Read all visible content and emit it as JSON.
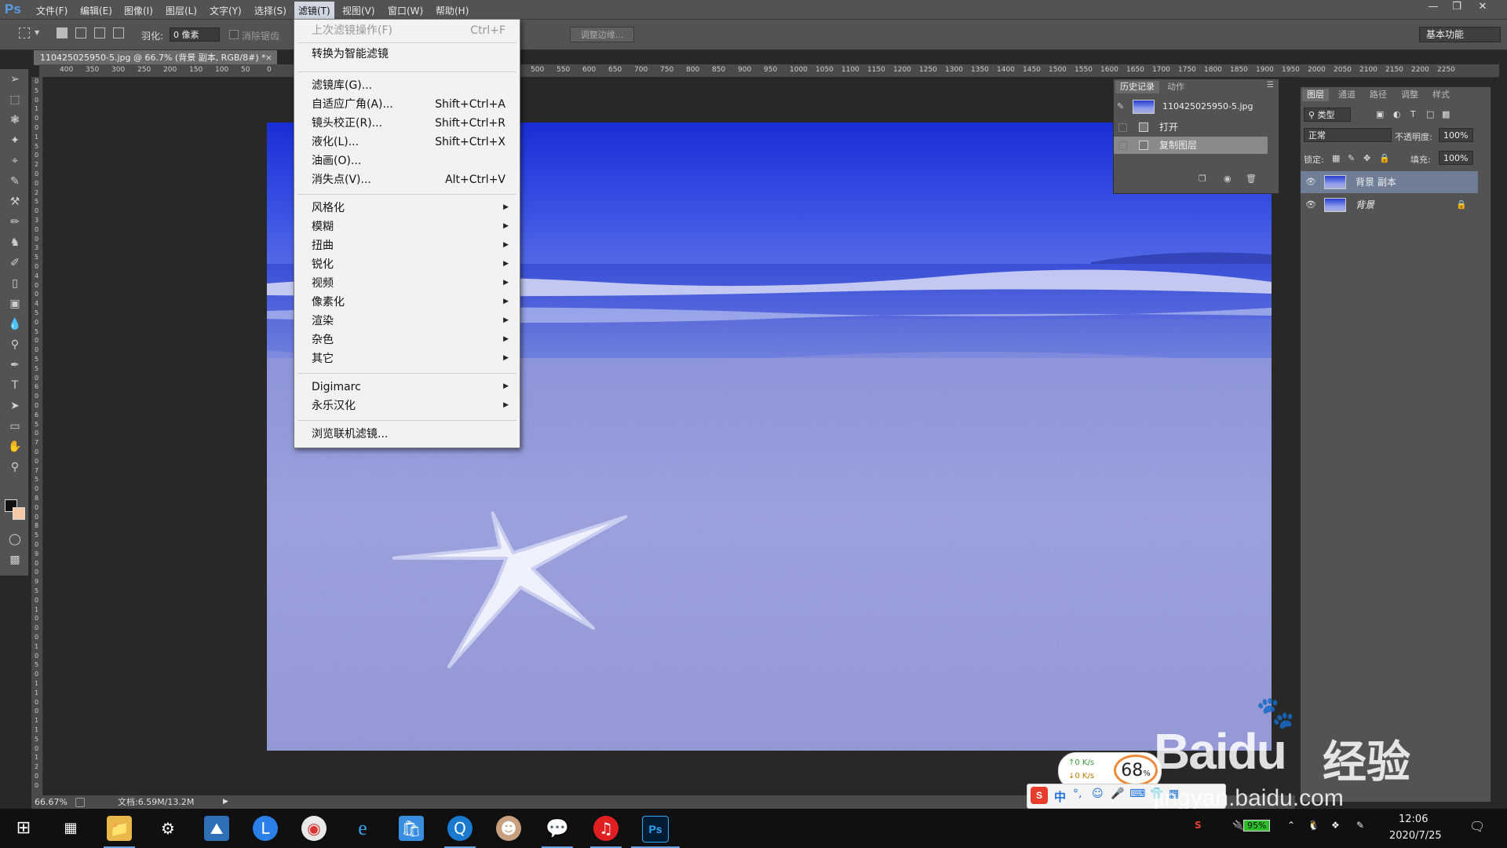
{
  "app": {
    "logo": "Ps"
  },
  "menubar": {
    "items": [
      "文件(F)",
      "编辑(E)",
      "图像(I)",
      "图层(L)",
      "文字(Y)",
      "选择(S)",
      "滤镜(T)",
      "视图(V)",
      "窗口(W)",
      "帮助(H)"
    ],
    "active_index": 6
  },
  "options_bar": {
    "feather_label": "羽化:",
    "feather_value": "0 像素",
    "antialias_label": "消除锯齿",
    "refine_edge": "调整边缘...",
    "workspace": "基本功能"
  },
  "document": {
    "tab_title": "110425025950-5.jpg @ 66.7% (背景 副本, RGB/8#) *",
    "zoom": "66.67%",
    "doc_size": "文档:6.59M/13.2M"
  },
  "ruler_top": [
    "400",
    "350",
    "300",
    "250",
    "200",
    "150",
    "100",
    "50",
    "0",
    "500",
    "550",
    "600",
    "650",
    "700",
    "750",
    "800",
    "850",
    "900",
    "950",
    "1000",
    "1050",
    "1100",
    "1150",
    "1200",
    "1250",
    "1300",
    "1350",
    "1400",
    "1450",
    "1500",
    "1550",
    "1600",
    "1650",
    "1700",
    "1750",
    "1800",
    "1850",
    "1900",
    "1950",
    "2000",
    "2050",
    "2100",
    "2150",
    "2200",
    "2250"
  ],
  "filter_menu": {
    "items": [
      {
        "label": "上次滤镜操作(F)",
        "shortcut": "Ctrl+F",
        "disabled": true
      },
      {
        "label": "转换为智能滤镜",
        "shortcut": ""
      },
      {
        "label": "滤镜库(G)...",
        "shortcut": ""
      },
      {
        "label": "自适应广角(A)...",
        "shortcut": "Shift+Ctrl+A"
      },
      {
        "label": "镜头校正(R)...",
        "shortcut": "Shift+Ctrl+R"
      },
      {
        "label": "液化(L)...",
        "shortcut": "Shift+Ctrl+X"
      },
      {
        "label": "油画(O)...",
        "shortcut": ""
      },
      {
        "label": "消失点(V)...",
        "shortcut": "Alt+Ctrl+V"
      },
      {
        "label": "风格化",
        "submenu": true
      },
      {
        "label": "模糊",
        "submenu": true
      },
      {
        "label": "扭曲",
        "submenu": true
      },
      {
        "label": "锐化",
        "submenu": true
      },
      {
        "label": "视频",
        "submenu": true
      },
      {
        "label": "像素化",
        "submenu": true
      },
      {
        "label": "渲染",
        "submenu": true
      },
      {
        "label": "杂色",
        "submenu": true
      },
      {
        "label": "其它",
        "submenu": true
      },
      {
        "label": "Digimarc",
        "submenu": true
      },
      {
        "label": "永乐汉化",
        "submenu": true
      },
      {
        "label": "浏览联机滤镜...",
        "shortcut": ""
      }
    ]
  },
  "history_panel": {
    "tabs": [
      "历史记录",
      "动作"
    ],
    "snapshot": "110425025950-5.jpg",
    "items": [
      "打开",
      "复制图层"
    ]
  },
  "layers_panel": {
    "tabs": [
      "图层",
      "通道",
      "路径",
      "调整",
      "样式"
    ],
    "filter_kind": "类型",
    "blend_mode": "正常",
    "opacity_label": "不透明度:",
    "opacity": "100%",
    "lock_label": "锁定:",
    "fill_label": "填充:",
    "fill": "100%",
    "layers": [
      {
        "name": "背景 副本",
        "selected": true
      },
      {
        "name": "背景",
        "locked": true
      }
    ]
  },
  "taskbar": {
    "time": "12:06",
    "date": "2020/7/25",
    "battery": "95%"
  },
  "net_widget": {
    "up": "0  K/s",
    "down": "0  K/s",
    "percent": "68",
    "percent_unit": "%"
  },
  "ime": {
    "mode": "中"
  },
  "watermark": {
    "brand": "Baidu",
    "cn": "经验",
    "url": "jingyan.baidu.com"
  }
}
